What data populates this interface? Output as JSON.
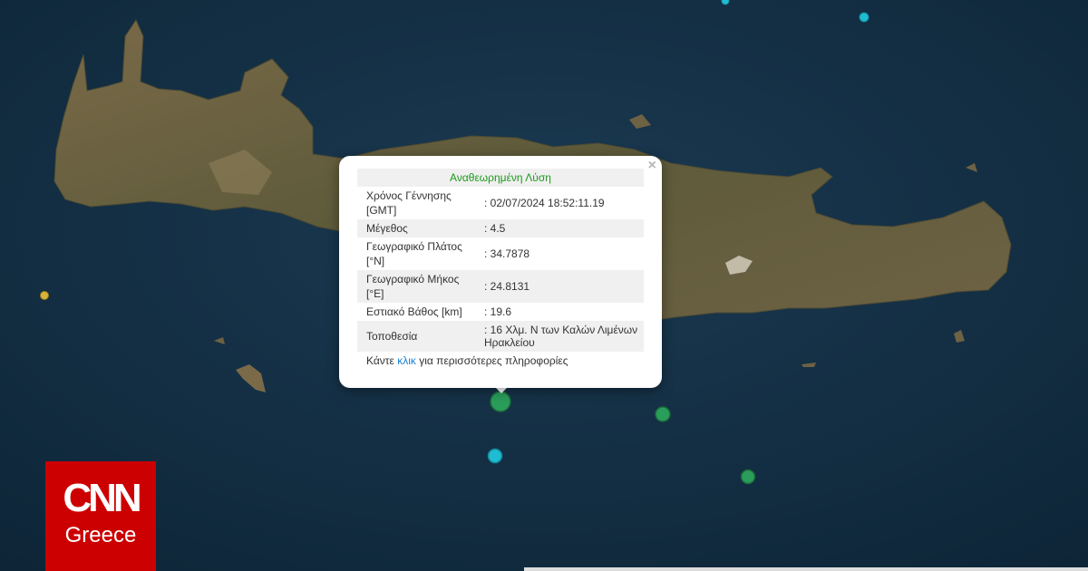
{
  "popup": {
    "title": "Αναθεωρημένη Λύση",
    "close_symbol": "×",
    "rows": [
      {
        "label": "Χρόνος Γέννησης [GMT]",
        "value": ": 02/07/2024 18:52:11.19"
      },
      {
        "label": "Μέγεθος",
        "value": ": 4.5"
      },
      {
        "label": "Γεωγραφικό Πλάτος [°N]",
        "value": ": 34.7878"
      },
      {
        "label": "Γεωγραφικό Μήκος [°E]",
        "value": ": 24.8131"
      },
      {
        "label": "Εστιακό Βάθος [km]",
        "value": ": 19.6"
      },
      {
        "label": "Τοποθεσία",
        "value": ": 16 Χλμ. Ν των Καλών Λιμένων Ηρακλείου"
      }
    ],
    "footer_before": "Κάντε ",
    "footer_link": "κλικ",
    "footer_after": " για περισσότερες πληροφορίες"
  },
  "logo": {
    "brand": "CNN",
    "region": "Greece",
    "color": "#cc0000"
  },
  "markers": {
    "colors": {
      "recent": "#2a9d5a",
      "older": "#1fbcd2",
      "oldest": "#d9b23a"
    },
    "icon": "earthquake-epicenter-dot"
  }
}
